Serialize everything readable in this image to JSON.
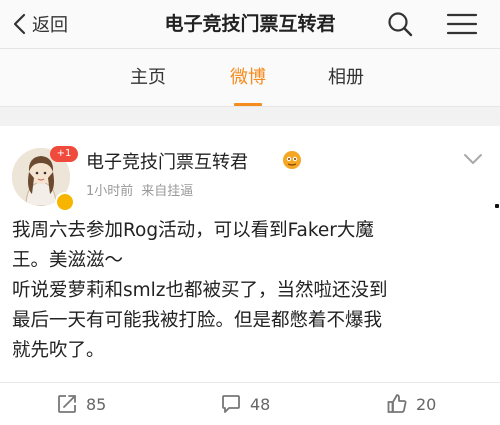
{
  "header": {
    "back_label": "返回",
    "title": "电子竞技门票互转君"
  },
  "tabs": [
    {
      "label": "主页",
      "active": false
    },
    {
      "label": "微博",
      "active": true
    },
    {
      "label": "相册",
      "active": false
    }
  ],
  "post": {
    "avatar_badge": "+1",
    "author": "电子竞技门票互转君",
    "time": "1小时前",
    "source": "来自挂逼",
    "lines": [
      "我周六去参加Rog活动，可以看到Faker大魔",
      "王。美滋滋～",
      "听说爱萝莉和smlz也都被买了，当然啦还没到",
      "最后一天有可能我被打脸。但是都憋着不爆我",
      "就先吹了。"
    ]
  },
  "actions": {
    "reposts": "85",
    "comments": "48",
    "likes": "20"
  },
  "colors": {
    "accent": "#f58c1f",
    "badge": "#f04a3c",
    "verified": "#f7b500"
  }
}
